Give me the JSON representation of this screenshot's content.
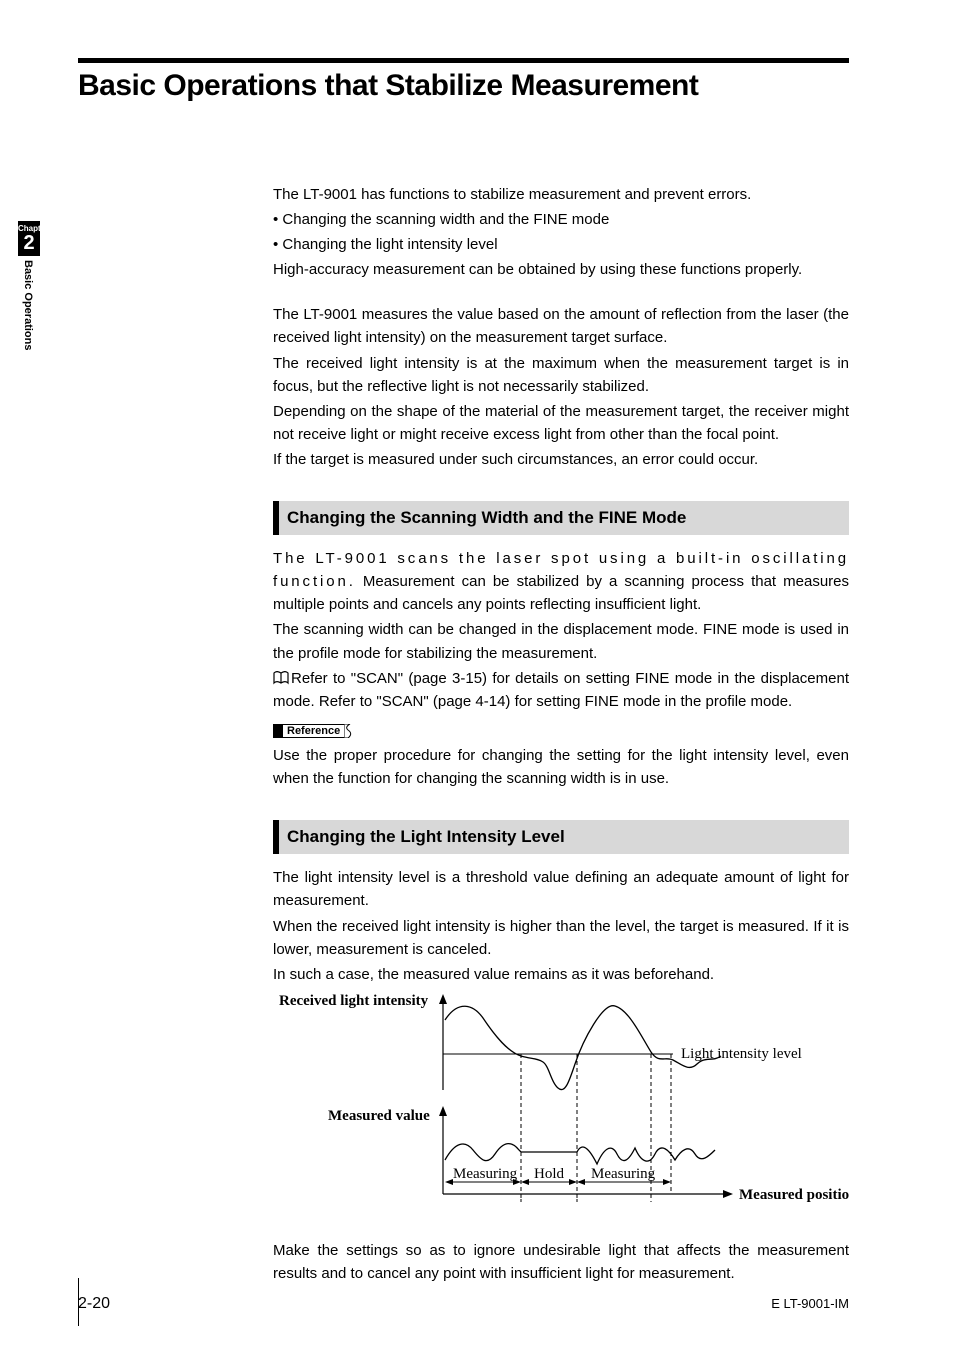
{
  "side": {
    "chapter_label": "Chapter",
    "chapter_number": "2",
    "chapter_title": "Basic Operations"
  },
  "title": "Basic Operations that Stabilize Measurement",
  "intro": {
    "p1": "The LT-9001 has functions to stabilize measurement and prevent errors.",
    "b1": "• Changing the scanning width and the FINE mode",
    "b2": "• Changing the light intensity level",
    "p2": "High-accuracy measurement can be obtained by using these functions properly.",
    "p3": "The LT-9001 measures the value based on the amount of reflection from the laser (the received light intensity) on the measurement target surface.",
    "p4": "The received light intensity is at the maximum when the measurement target is in focus, but the reflective light is not necessarily stabilized.",
    "p5": "Depending on the shape of the material of the measurement target, the receiver might not receive light or might receive excess light from other than the focal point.",
    "p6": "If the target is measured under such circumstances, an error could occur."
  },
  "sec1": {
    "heading": "Changing the Scanning Width and the FINE Mode",
    "p1": "The LT-9001 scans the laser spot using a built-in oscillating function. Measurement can be stabilized by a scanning process that measures multiple points and cancels any points reflecting insufficient light.",
    "p1_first": "The LT-9001 scans the laser spot using a built-in oscillating function.",
    "p1_rest": "Measurement can be stabilized by a scanning process that measures multiple points and cancels any points reflecting insufficient light.",
    "p2": "The scanning width can be changed in the displacement mode. FINE mode is used in the profile mode for stabilizing the measurement.",
    "ref": "Refer to \"SCAN\" (page 3-15) for details on setting FINE mode in the displacement mode. Refer to \"SCAN\" (page 4-14) for setting FINE mode in the profile mode.",
    "reference_tag": "Reference",
    "p3": "Use the proper procedure for changing the setting for the light intensity level, even when the function for changing the scanning width is in use."
  },
  "sec2": {
    "heading": "Changing the Light Intensity Level",
    "p1": "The light intensity level is a threshold value defining an adequate amount of light for measurement.",
    "p2": "When the received light intensity is higher than the level, the target is measured. If it is lower, measurement is canceled.",
    "p3": "In such a case, the measured value remains as it was beforehand.",
    "p4": "Make the settings so as to ignore undesirable light that affects the measurement results and to cancel any point with insufficient light for measurement."
  },
  "diagram": {
    "y1_label": "Received light intensity",
    "y2_label": "Measured value",
    "threshold_label": "Light intensity level",
    "x_label": "Measured position",
    "region1": "Measuring",
    "region2": "Hold",
    "region3": "Measuring"
  },
  "footer": {
    "page_number": "2-20",
    "doc_id": "E LT-9001-IM"
  },
  "chart_data": {
    "type": "line",
    "title": "",
    "panels": [
      {
        "name": "Received light intensity",
        "ylabel": "Received light intensity",
        "threshold_line": 0.45,
        "threshold_label": "Light intensity level",
        "x": [
          0.0,
          0.05,
          0.1,
          0.15,
          0.2,
          0.25,
          0.3,
          0.35,
          0.38,
          0.4,
          0.45,
          0.48,
          0.5,
          0.55,
          0.58,
          0.6,
          0.65,
          0.7,
          0.75,
          0.8,
          0.85,
          0.9,
          0.95,
          1.0
        ],
        "y": [
          0.78,
          0.93,
          0.83,
          0.58,
          0.45,
          0.4,
          0.42,
          0.4,
          0.3,
          0.2,
          0.1,
          0.2,
          0.3,
          0.82,
          1.0,
          0.95,
          0.7,
          0.55,
          0.45,
          0.48,
          0.42,
          0.35,
          0.4,
          0.45
        ],
        "x_crossings_below_threshold": [
          0.204,
          0.725
        ],
        "x_crossings_above_threshold": [
          0.527,
          0.8
        ]
      },
      {
        "name": "Measured value",
        "ylabel": "Measured value",
        "xlabel": "Measured position",
        "regions": [
          {
            "label": "Measuring",
            "x_start": 0.0,
            "x_end": 0.38,
            "behavior": "tracking"
          },
          {
            "label": "Hold",
            "x_start": 0.38,
            "x_end": 0.53,
            "behavior": "hold-last"
          },
          {
            "label": "Measuring",
            "x_start": 0.53,
            "x_end": 1.0,
            "behavior": "tracking"
          }
        ],
        "x": [
          0.0,
          0.05,
          0.1,
          0.15,
          0.2,
          0.25,
          0.3,
          0.35,
          0.38,
          0.53,
          0.55,
          0.6,
          0.63,
          0.68,
          0.72,
          0.78,
          0.82,
          0.88,
          0.92,
          0.98,
          1.0
        ],
        "y": [
          0.2,
          0.4,
          0.5,
          0.4,
          0.22,
          0.18,
          0.4,
          0.5,
          0.4,
          0.4,
          0.58,
          0.42,
          0.25,
          0.5,
          0.35,
          0.2,
          0.48,
          0.35,
          0.18,
          0.42,
          0.35
        ]
      }
    ]
  }
}
